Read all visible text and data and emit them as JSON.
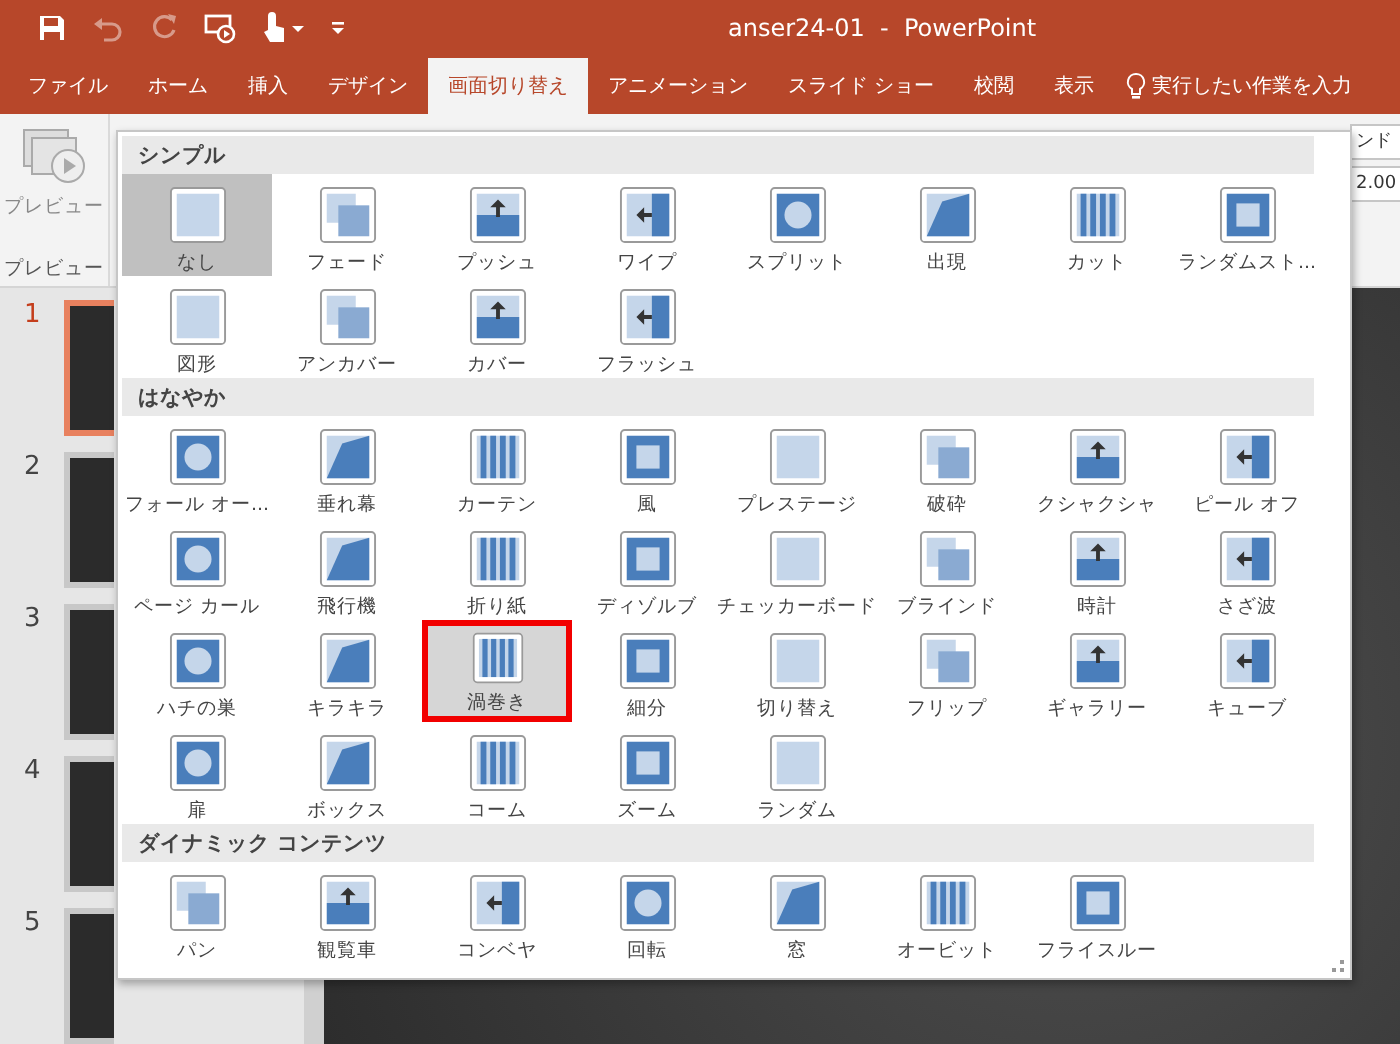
{
  "window": {
    "title": "anser24-01  -  PowerPoint"
  },
  "quick_access": [
    {
      "kind": "save",
      "disabled": false
    },
    {
      "kind": "undo",
      "disabled": true
    },
    {
      "kind": "redo",
      "disabled": true
    },
    {
      "kind": "slideshow",
      "disabled": false
    },
    {
      "kind": "touch",
      "disabled": false
    },
    {
      "kind": "customize",
      "disabled": false
    }
  ],
  "tabs": [
    {
      "label": "ファイル",
      "selected": false
    },
    {
      "label": "ホーム",
      "selected": false
    },
    {
      "label": "挿入",
      "selected": false
    },
    {
      "label": "デザイン",
      "selected": false
    },
    {
      "label": "画面切り替え",
      "selected": true
    },
    {
      "label": "アニメーション",
      "selected": false
    },
    {
      "label": "スライド ショー",
      "selected": false
    },
    {
      "label": "校閲",
      "selected": false
    },
    {
      "label": "表示",
      "selected": false
    }
  ],
  "tell_me": {
    "placeholder": "実行したい作業を入力"
  },
  "ribbon": {
    "preview_button": "プレビュー",
    "group_label": "プレビュー",
    "fields": [
      "ンド",
      "2.00"
    ]
  },
  "slides": [
    {
      "number": "1",
      "selected": true
    },
    {
      "number": "2",
      "selected": false
    },
    {
      "number": "3",
      "selected": false
    },
    {
      "number": "4",
      "selected": false
    },
    {
      "number": "5",
      "selected": false
    }
  ],
  "gallery": {
    "sections": [
      {
        "title": "シンプル",
        "items": [
          {
            "label": "なし",
            "selected": true,
            "highlighted": false
          },
          {
            "label": "フェード",
            "selected": false,
            "highlighted": false
          },
          {
            "label": "プッシュ",
            "selected": false,
            "highlighted": false
          },
          {
            "label": "ワイプ",
            "selected": false,
            "highlighted": false
          },
          {
            "label": "スプリット",
            "selected": false,
            "highlighted": false
          },
          {
            "label": "出現",
            "selected": false,
            "highlighted": false
          },
          {
            "label": "カット",
            "selected": false,
            "highlighted": false
          },
          {
            "label": "ランダムスト...",
            "selected": false,
            "highlighted": false
          },
          {
            "label": "図形",
            "selected": false,
            "highlighted": false
          },
          {
            "label": "アンカバー",
            "selected": false,
            "highlighted": false
          },
          {
            "label": "カバー",
            "selected": false,
            "highlighted": false
          },
          {
            "label": "フラッシュ",
            "selected": false,
            "highlighted": false
          }
        ]
      },
      {
        "title": "はなやか",
        "items": [
          {
            "label": "フォール オー...",
            "selected": false,
            "highlighted": false
          },
          {
            "label": "垂れ幕",
            "selected": false,
            "highlighted": false
          },
          {
            "label": "カーテン",
            "selected": false,
            "highlighted": false
          },
          {
            "label": "風",
            "selected": false,
            "highlighted": false
          },
          {
            "label": "プレステージ",
            "selected": false,
            "highlighted": false
          },
          {
            "label": "破砕",
            "selected": false,
            "highlighted": false
          },
          {
            "label": "クシャクシャ",
            "selected": false,
            "highlighted": false
          },
          {
            "label": "ピール オフ",
            "selected": false,
            "highlighted": false
          },
          {
            "label": "ページ カール",
            "selected": false,
            "highlighted": false
          },
          {
            "label": "飛行機",
            "selected": false,
            "highlighted": false
          },
          {
            "label": "折り紙",
            "selected": false,
            "highlighted": false
          },
          {
            "label": "ディゾルブ",
            "selected": false,
            "highlighted": false
          },
          {
            "label": "チェッカーボード",
            "selected": false,
            "highlighted": false
          },
          {
            "label": "ブラインド",
            "selected": false,
            "highlighted": false
          },
          {
            "label": "時計",
            "selected": false,
            "highlighted": false
          },
          {
            "label": "さざ波",
            "selected": false,
            "highlighted": false
          },
          {
            "label": "ハチの巣",
            "selected": false,
            "highlighted": false
          },
          {
            "label": "キラキラ",
            "selected": false,
            "highlighted": false
          },
          {
            "label": "渦巻き",
            "selected": false,
            "highlighted": true
          },
          {
            "label": "細分",
            "selected": false,
            "highlighted": false
          },
          {
            "label": "切り替え",
            "selected": false,
            "highlighted": false
          },
          {
            "label": "フリップ",
            "selected": false,
            "highlighted": false
          },
          {
            "label": "ギャラリー",
            "selected": false,
            "highlighted": false
          },
          {
            "label": "キューブ",
            "selected": false,
            "highlighted": false
          },
          {
            "label": "扉",
            "selected": false,
            "highlighted": false
          },
          {
            "label": "ボックス",
            "selected": false,
            "highlighted": false
          },
          {
            "label": "コーム",
            "selected": false,
            "highlighted": false
          },
          {
            "label": "ズーム",
            "selected": false,
            "highlighted": false
          },
          {
            "label": "ランダム",
            "selected": false,
            "highlighted": false
          }
        ]
      },
      {
        "title": "ダイナミック コンテンツ",
        "items": [
          {
            "label": "パン",
            "selected": false,
            "highlighted": false
          },
          {
            "label": "観覧車",
            "selected": false,
            "highlighted": false
          },
          {
            "label": "コンベヤ",
            "selected": false,
            "highlighted": false
          },
          {
            "label": "回転",
            "selected": false,
            "highlighted": false
          },
          {
            "label": "窓",
            "selected": false,
            "highlighted": false
          },
          {
            "label": "オービット",
            "selected": false,
            "highlighted": false
          },
          {
            "label": "フライスルー",
            "selected": false,
            "highlighted": false
          }
        ]
      }
    ]
  }
}
